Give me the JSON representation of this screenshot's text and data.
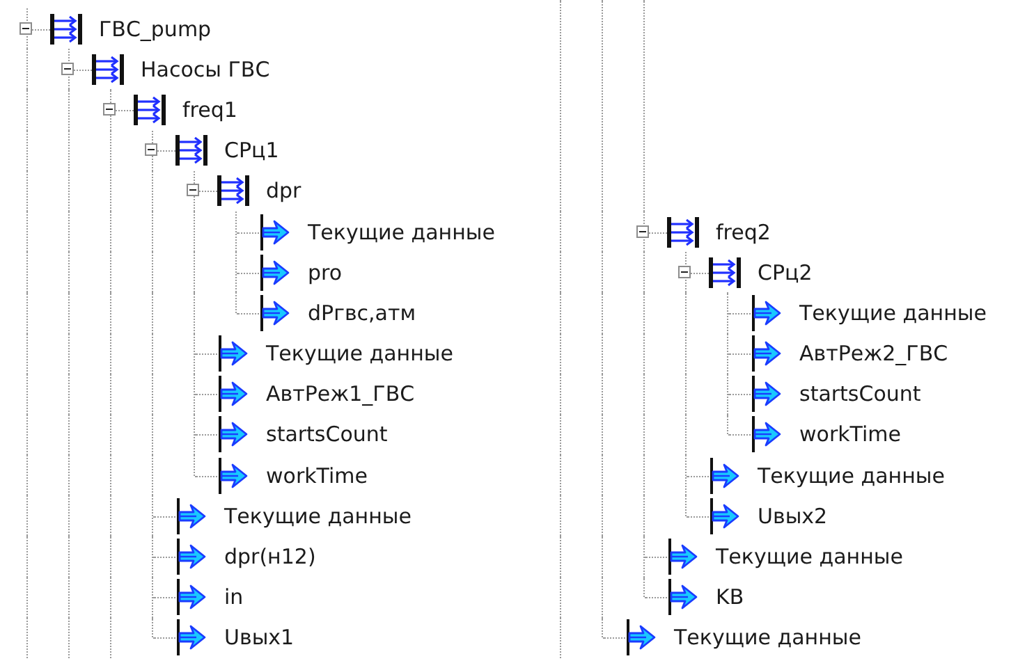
{
  "columns": [
    {
      "nodes": [
        {
          "label": "ГВС_pump",
          "kind": "group",
          "expanded": true,
          "more_above": true,
          "more_below": true,
          "children": [
            {
              "label": "Насосы ГВС",
              "kind": "group",
              "expanded": true,
              "more_below": true,
              "children": [
                {
                  "label": "freq1",
                  "kind": "group",
                  "expanded": true,
                  "more_below": true,
                  "children": [
                    {
                      "label": "СРц1",
                      "kind": "group",
                      "expanded": true,
                      "children": [
                        {
                          "label": "dpr",
                          "kind": "group",
                          "expanded": true,
                          "children": [
                            {
                              "label": "Текущие данные",
                              "kind": "signal"
                            },
                            {
                              "label": "pro",
                              "kind": "signal"
                            },
                            {
                              "label": "dPгвс,атм",
                              "kind": "signal"
                            }
                          ]
                        },
                        {
                          "label": "Текущие данные",
                          "kind": "signal"
                        },
                        {
                          "label": "АвтРеж1_ГВС",
                          "kind": "signal"
                        },
                        {
                          "label": "startsCount",
                          "kind": "signal"
                        },
                        {
                          "label": "workTime",
                          "kind": "signal"
                        }
                      ]
                    },
                    {
                      "label": "Текущие данные",
                      "kind": "signal"
                    },
                    {
                      "label": "dpr(н12)",
                      "kind": "signal"
                    },
                    {
                      "label": "in",
                      "kind": "signal"
                    },
                    {
                      "label": "Uвых1",
                      "kind": "signal"
                    }
                  ]
                }
              ]
            }
          ]
        }
      ]
    },
    {
      "nodes": [
        {
          "kind": "offscreen",
          "more_below": true,
          "children": [
            {
              "kind": "offscreen",
              "children": [
                {
                  "label": "freq2",
                  "kind": "group",
                  "expanded": true,
                  "children": [
                    {
                      "label": "СРц2",
                      "kind": "group",
                      "expanded": true,
                      "children": [
                        {
                          "label": "Текущие данные",
                          "kind": "signal"
                        },
                        {
                          "label": "АвтРеж2_ГВС",
                          "kind": "signal"
                        },
                        {
                          "label": "startsCount",
                          "kind": "signal"
                        },
                        {
                          "label": "workTime",
                          "kind": "signal"
                        }
                      ]
                    },
                    {
                      "label": "Текущие данные",
                      "kind": "signal"
                    },
                    {
                      "label": "Uвых2",
                      "kind": "signal"
                    }
                  ]
                },
                {
                  "label": "Текущие данные",
                  "kind": "signal"
                },
                {
                  "label": "KB",
                  "kind": "signal"
                }
              ]
            },
            {
              "label": "Текущие данные",
              "kind": "signal"
            }
          ]
        }
      ]
    }
  ]
}
